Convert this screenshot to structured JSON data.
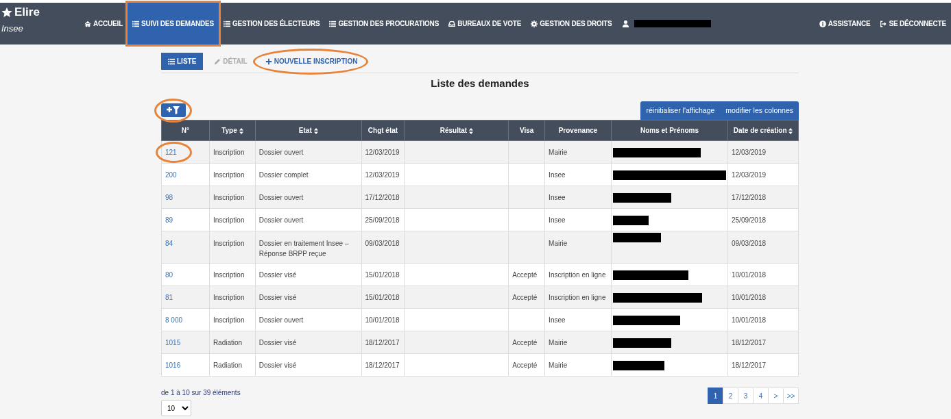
{
  "brand": {
    "title": "Elire",
    "subtitle": "Insee"
  },
  "nav": {
    "items": [
      {
        "label": "ACCUEIL",
        "selected": false,
        "highlighted": false
      },
      {
        "label": "SUIVI DES DEMANDES",
        "selected": true,
        "highlighted": true
      },
      {
        "label": "GESTION DES ÉLECTEURS",
        "selected": false,
        "highlighted": false
      },
      {
        "label": "GESTION DES PROCURATIONS",
        "selected": false,
        "highlighted": false
      },
      {
        "label": "BUREAUX DE VOTE",
        "selected": false,
        "highlighted": false
      },
      {
        "label": "GESTION DES DROITS",
        "selected": false,
        "highlighted": false
      }
    ],
    "right_items": [
      {
        "label": "ASSISTANCE"
      },
      {
        "label": "SE DÉCONNECTE"
      }
    ]
  },
  "subtabs": [
    {
      "label": "LISTE",
      "selected": true,
      "disabled": false,
      "highlighted": false
    },
    {
      "label": "DÉTAIL",
      "selected": false,
      "disabled": true,
      "highlighted": false
    },
    {
      "label": "NOUVELLE INSCRIPTION",
      "selected": false,
      "disabled": false,
      "highlighted": true
    }
  ],
  "title": "Liste des demandes",
  "filter_button": {
    "highlighted": true
  },
  "toolbar_buttons": [
    "réinitialiser l'affichage",
    "modifier les colonnes"
  ],
  "table": {
    "columns": [
      {
        "label": "N°",
        "sortable": false
      },
      {
        "label": "Type",
        "sortable": true
      },
      {
        "label": "Etat",
        "sortable": true
      },
      {
        "label": "Chgt état",
        "sortable": false
      },
      {
        "label": "Résultat",
        "sortable": true
      },
      {
        "label": "Visa",
        "sortable": false
      },
      {
        "label": "Provenance",
        "sortable": false
      },
      {
        "label": "Noms et Prénoms",
        "sortable": false
      },
      {
        "label": "Date de création",
        "sortable": true
      }
    ],
    "rows": [
      {
        "number": "121",
        "type": "Inscription",
        "state": "Dossier ouvert",
        "changed": "12/03/2019",
        "origin": "Mairie",
        "created": "12/03/2019",
        "highlighted": true
      },
      {
        "number": "200",
        "type": "Inscription",
        "state": "Dossier complet",
        "changed": "12/03/2019",
        "origin": "Insee",
        "created": "12/03/2019",
        "highlighted": false
      },
      {
        "number": "98",
        "type": "Inscription",
        "state": "Dossier ouvert",
        "changed": "17/12/2018",
        "origin": "Insee",
        "created": "17/12/2018",
        "highlighted": false
      },
      {
        "number": "89",
        "type": "Inscription",
        "state": "Dossier ouvert",
        "changed": "25/09/2018",
        "origin": "Insee",
        "created": "25/09/2018",
        "highlighted": false
      },
      {
        "number": "84",
        "type": "Inscription",
        "state": "Dossier en traitement Insee – Réponse BRPP reçue",
        "changed": "09/03/2018",
        "origin": "Mairie",
        "created": "09/03/2018",
        "highlighted": false
      },
      {
        "number": "80",
        "type": "Inscription",
        "state": "Dossier visé",
        "changed": "15/01/2018",
        "visa": "Accepté",
        "origin": "Inscription en ligne",
        "created": "10/01/2018",
        "highlighted": false
      },
      {
        "number": "81",
        "type": "Inscription",
        "state": "Dossier visé",
        "changed": "15/01/2018",
        "visa": "Accepté",
        "origin": "Inscription en ligne",
        "created": "10/01/2018",
        "highlighted": false
      },
      {
        "number": "8 000",
        "type": "Inscription",
        "state": "Dossier ouvert",
        "changed": "10/01/2018",
        "origin": "Insee",
        "created": "10/01/2018",
        "highlighted": false
      },
      {
        "number": "1015",
        "type": "Radiation",
        "state": "Dossier visé",
        "changed": "18/12/2017",
        "visa": "Accepté",
        "origin": "Mairie",
        "created": "18/12/2017",
        "highlighted": false
      },
      {
        "number": "1016",
        "type": "Radiation",
        "state": "Dossier visé",
        "changed": "18/12/2017",
        "visa": "Accepté",
        "origin": "Mairie",
        "created": "18/12/2017",
        "highlighted": false
      }
    ]
  },
  "footer": {
    "summary": "de 1 à 10 sur 39 éléments",
    "page_size": "10"
  },
  "pagination": [
    {
      "label": "1",
      "selected": true
    },
    {
      "label": "2",
      "selected": false
    },
    {
      "label": "3",
      "selected": false
    },
    {
      "label": "4",
      "selected": false
    },
    {
      "label": ">",
      "selected": false
    },
    {
      "label": ">>",
      "selected": false
    }
  ]
}
